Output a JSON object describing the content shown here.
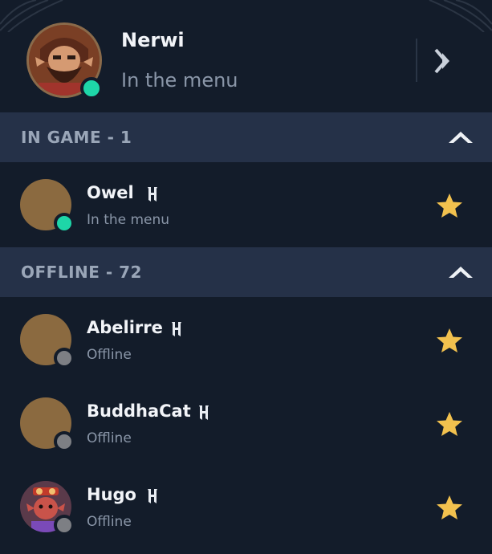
{
  "profile": {
    "name": "Nerwi",
    "status_text": "In the menu",
    "status_color": "#1ed6a8"
  },
  "colors": {
    "online": "#1ed6a8",
    "offline": "#7d7f84",
    "star": "#f2c14e",
    "header_bg": "#253148",
    "background": "#131c2a"
  },
  "sections": [
    {
      "title": "IN GAME - 1",
      "friends": [
        {
          "name": "Owel",
          "status_text": "In the menu",
          "status": "online",
          "favorite": true,
          "avatar": "placeholder"
        }
      ]
    },
    {
      "title": "OFFLINE - 72",
      "friends": [
        {
          "name": "Abelirre",
          "status_text": "Offline",
          "status": "offline",
          "favorite": true,
          "avatar": "placeholder"
        },
        {
          "name": "BuddhaCat",
          "status_text": "Offline",
          "status": "offline",
          "favorite": true,
          "avatar": "placeholder"
        },
        {
          "name": "Hugo",
          "status_text": "Offline",
          "status": "offline",
          "favorite": true,
          "avatar": "character"
        }
      ]
    }
  ],
  "icons": {
    "collapse": "double-chevron-right-icon",
    "section_toggle": "chevron-up-icon",
    "favorite": "star-icon",
    "badge": "h-rune-icon"
  }
}
